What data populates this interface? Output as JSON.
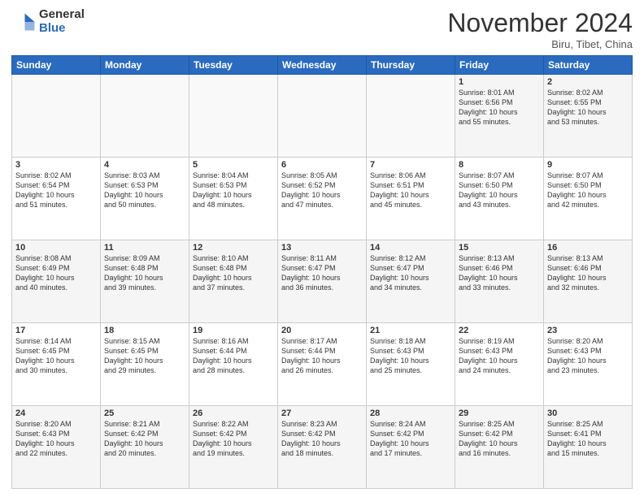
{
  "header": {
    "logo_general": "General",
    "logo_blue": "Blue",
    "month_title": "November 2024",
    "location": "Biru, Tibet, China"
  },
  "days_of_week": [
    "Sunday",
    "Monday",
    "Tuesday",
    "Wednesday",
    "Thursday",
    "Friday",
    "Saturday"
  ],
  "weeks": [
    [
      {
        "day": "",
        "info": ""
      },
      {
        "day": "",
        "info": ""
      },
      {
        "day": "",
        "info": ""
      },
      {
        "day": "",
        "info": ""
      },
      {
        "day": "",
        "info": ""
      },
      {
        "day": "1",
        "info": "Sunrise: 8:01 AM\nSunset: 6:56 PM\nDaylight: 10 hours\nand 55 minutes."
      },
      {
        "day": "2",
        "info": "Sunrise: 8:02 AM\nSunset: 6:55 PM\nDaylight: 10 hours\nand 53 minutes."
      }
    ],
    [
      {
        "day": "3",
        "info": "Sunrise: 8:02 AM\nSunset: 6:54 PM\nDaylight: 10 hours\nand 51 minutes."
      },
      {
        "day": "4",
        "info": "Sunrise: 8:03 AM\nSunset: 6:53 PM\nDaylight: 10 hours\nand 50 minutes."
      },
      {
        "day": "5",
        "info": "Sunrise: 8:04 AM\nSunset: 6:53 PM\nDaylight: 10 hours\nand 48 minutes."
      },
      {
        "day": "6",
        "info": "Sunrise: 8:05 AM\nSunset: 6:52 PM\nDaylight: 10 hours\nand 47 minutes."
      },
      {
        "day": "7",
        "info": "Sunrise: 8:06 AM\nSunset: 6:51 PM\nDaylight: 10 hours\nand 45 minutes."
      },
      {
        "day": "8",
        "info": "Sunrise: 8:07 AM\nSunset: 6:50 PM\nDaylight: 10 hours\nand 43 minutes."
      },
      {
        "day": "9",
        "info": "Sunrise: 8:07 AM\nSunset: 6:50 PM\nDaylight: 10 hours\nand 42 minutes."
      }
    ],
    [
      {
        "day": "10",
        "info": "Sunrise: 8:08 AM\nSunset: 6:49 PM\nDaylight: 10 hours\nand 40 minutes."
      },
      {
        "day": "11",
        "info": "Sunrise: 8:09 AM\nSunset: 6:48 PM\nDaylight: 10 hours\nand 39 minutes."
      },
      {
        "day": "12",
        "info": "Sunrise: 8:10 AM\nSunset: 6:48 PM\nDaylight: 10 hours\nand 37 minutes."
      },
      {
        "day": "13",
        "info": "Sunrise: 8:11 AM\nSunset: 6:47 PM\nDaylight: 10 hours\nand 36 minutes."
      },
      {
        "day": "14",
        "info": "Sunrise: 8:12 AM\nSunset: 6:47 PM\nDaylight: 10 hours\nand 34 minutes."
      },
      {
        "day": "15",
        "info": "Sunrise: 8:13 AM\nSunset: 6:46 PM\nDaylight: 10 hours\nand 33 minutes."
      },
      {
        "day": "16",
        "info": "Sunrise: 8:13 AM\nSunset: 6:46 PM\nDaylight: 10 hours\nand 32 minutes."
      }
    ],
    [
      {
        "day": "17",
        "info": "Sunrise: 8:14 AM\nSunset: 6:45 PM\nDaylight: 10 hours\nand 30 minutes."
      },
      {
        "day": "18",
        "info": "Sunrise: 8:15 AM\nSunset: 6:45 PM\nDaylight: 10 hours\nand 29 minutes."
      },
      {
        "day": "19",
        "info": "Sunrise: 8:16 AM\nSunset: 6:44 PM\nDaylight: 10 hours\nand 28 minutes."
      },
      {
        "day": "20",
        "info": "Sunrise: 8:17 AM\nSunset: 6:44 PM\nDaylight: 10 hours\nand 26 minutes."
      },
      {
        "day": "21",
        "info": "Sunrise: 8:18 AM\nSunset: 6:43 PM\nDaylight: 10 hours\nand 25 minutes."
      },
      {
        "day": "22",
        "info": "Sunrise: 8:19 AM\nSunset: 6:43 PM\nDaylight: 10 hours\nand 24 minutes."
      },
      {
        "day": "23",
        "info": "Sunrise: 8:20 AM\nSunset: 6:43 PM\nDaylight: 10 hours\nand 23 minutes."
      }
    ],
    [
      {
        "day": "24",
        "info": "Sunrise: 8:20 AM\nSunset: 6:43 PM\nDaylight: 10 hours\nand 22 minutes."
      },
      {
        "day": "25",
        "info": "Sunrise: 8:21 AM\nSunset: 6:42 PM\nDaylight: 10 hours\nand 20 minutes."
      },
      {
        "day": "26",
        "info": "Sunrise: 8:22 AM\nSunset: 6:42 PM\nDaylight: 10 hours\nand 19 minutes."
      },
      {
        "day": "27",
        "info": "Sunrise: 8:23 AM\nSunset: 6:42 PM\nDaylight: 10 hours\nand 18 minutes."
      },
      {
        "day": "28",
        "info": "Sunrise: 8:24 AM\nSunset: 6:42 PM\nDaylight: 10 hours\nand 17 minutes."
      },
      {
        "day": "29",
        "info": "Sunrise: 8:25 AM\nSunset: 6:42 PM\nDaylight: 10 hours\nand 16 minutes."
      },
      {
        "day": "30",
        "info": "Sunrise: 8:25 AM\nSunset: 6:41 PM\nDaylight: 10 hours\nand 15 minutes."
      }
    ]
  ]
}
